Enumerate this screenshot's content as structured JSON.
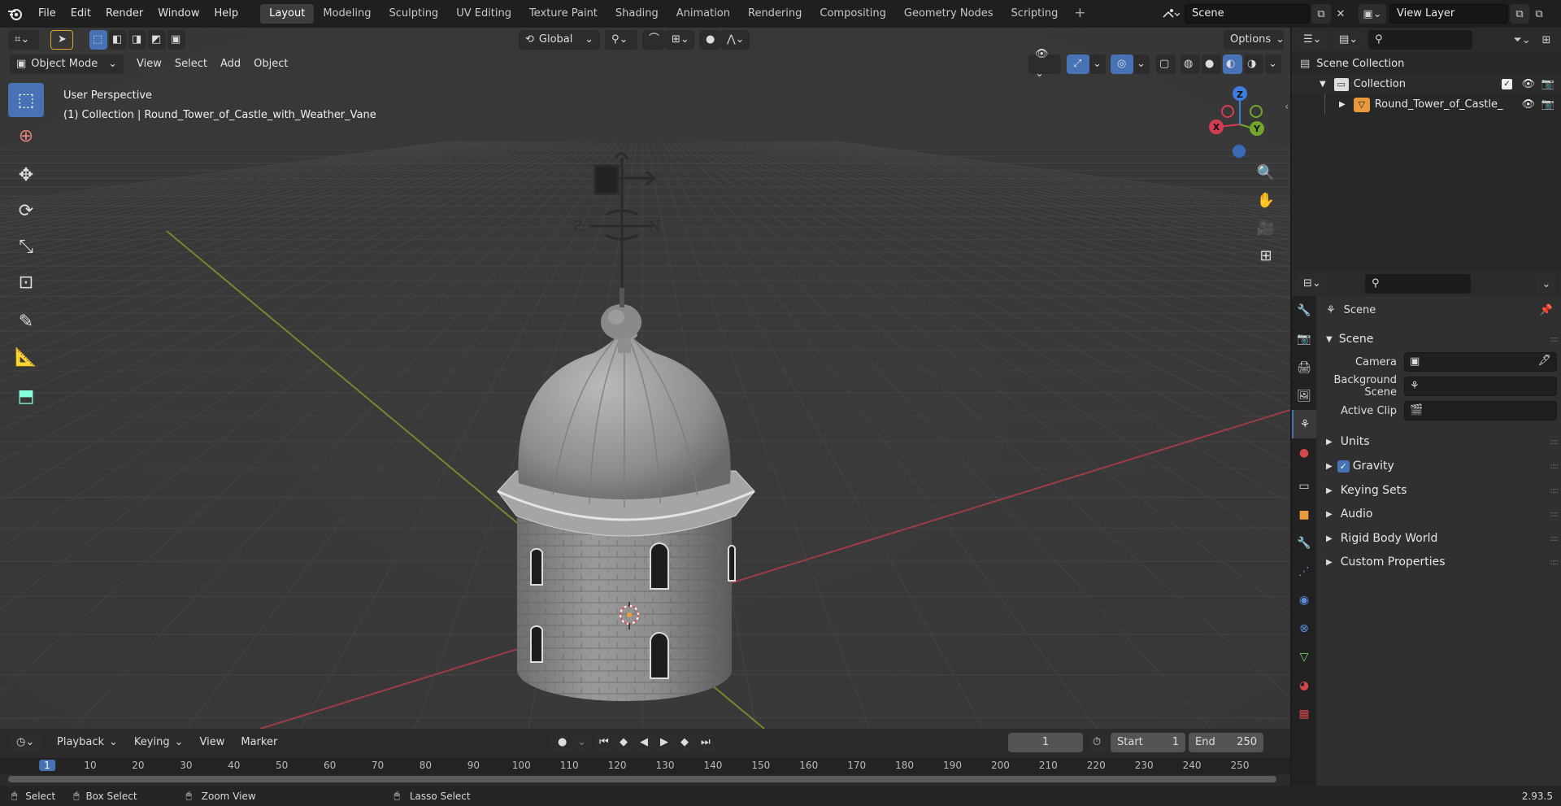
{
  "menus": [
    "File",
    "Edit",
    "Render",
    "Window",
    "Help"
  ],
  "workspaces": [
    "Layout",
    "Modeling",
    "Sculpting",
    "UV Editing",
    "Texture Paint",
    "Shading",
    "Animation",
    "Rendering",
    "Compositing",
    "Geometry Nodes",
    "Scripting"
  ],
  "scene_name": "Scene",
  "view_layer": "View Layer",
  "viewport": {
    "orientation": "Global",
    "options_label": "Options",
    "mode": "Object Mode",
    "header_menus": [
      "View",
      "Select",
      "Add",
      "Object"
    ],
    "perspective": "User Perspective",
    "collection_info": "(1) Collection | Round_Tower_of_Castle_with_Weather_Vane",
    "gizmo_axes": {
      "x": "X",
      "y": "Y",
      "z": "Z"
    },
    "vane_letters": {
      "n": "N",
      "s": "S"
    }
  },
  "timeline": {
    "menus": [
      "Playback",
      "Keying",
      "View",
      "Marker"
    ],
    "current_frame": "1",
    "start_label": "Start",
    "start_value": "1",
    "end_label": "End",
    "end_value": "250",
    "ticks": [
      "1",
      "10",
      "20",
      "30",
      "40",
      "50",
      "60",
      "70",
      "80",
      "90",
      "100",
      "110",
      "120",
      "130",
      "140",
      "150",
      "160",
      "170",
      "180",
      "190",
      "200",
      "210",
      "220",
      "230",
      "240",
      "250"
    ]
  },
  "statusbar": {
    "select": "Select",
    "box_select": "Box Select",
    "zoom_view": "Zoom View",
    "lasso_select": "Lasso Select",
    "version": "2.93.5"
  },
  "outliner": {
    "root": "Scene Collection",
    "collection": "Collection",
    "object": "Round_Tower_of_Castle_"
  },
  "properties": {
    "context": "Scene",
    "panel": "Scene",
    "camera_label": "Camera",
    "background_scene_label": "Background Scene",
    "active_clip_label": "Active Clip",
    "subpanels": [
      "Units",
      "Gravity",
      "Keying Sets",
      "Audio",
      "Rigid Body World",
      "Custom Properties"
    ]
  },
  "colors": {
    "accent": "#4772b3",
    "x_axis": "#d63c52",
    "y_axis": "#74a52a",
    "z_axis": "#3f7de0"
  }
}
